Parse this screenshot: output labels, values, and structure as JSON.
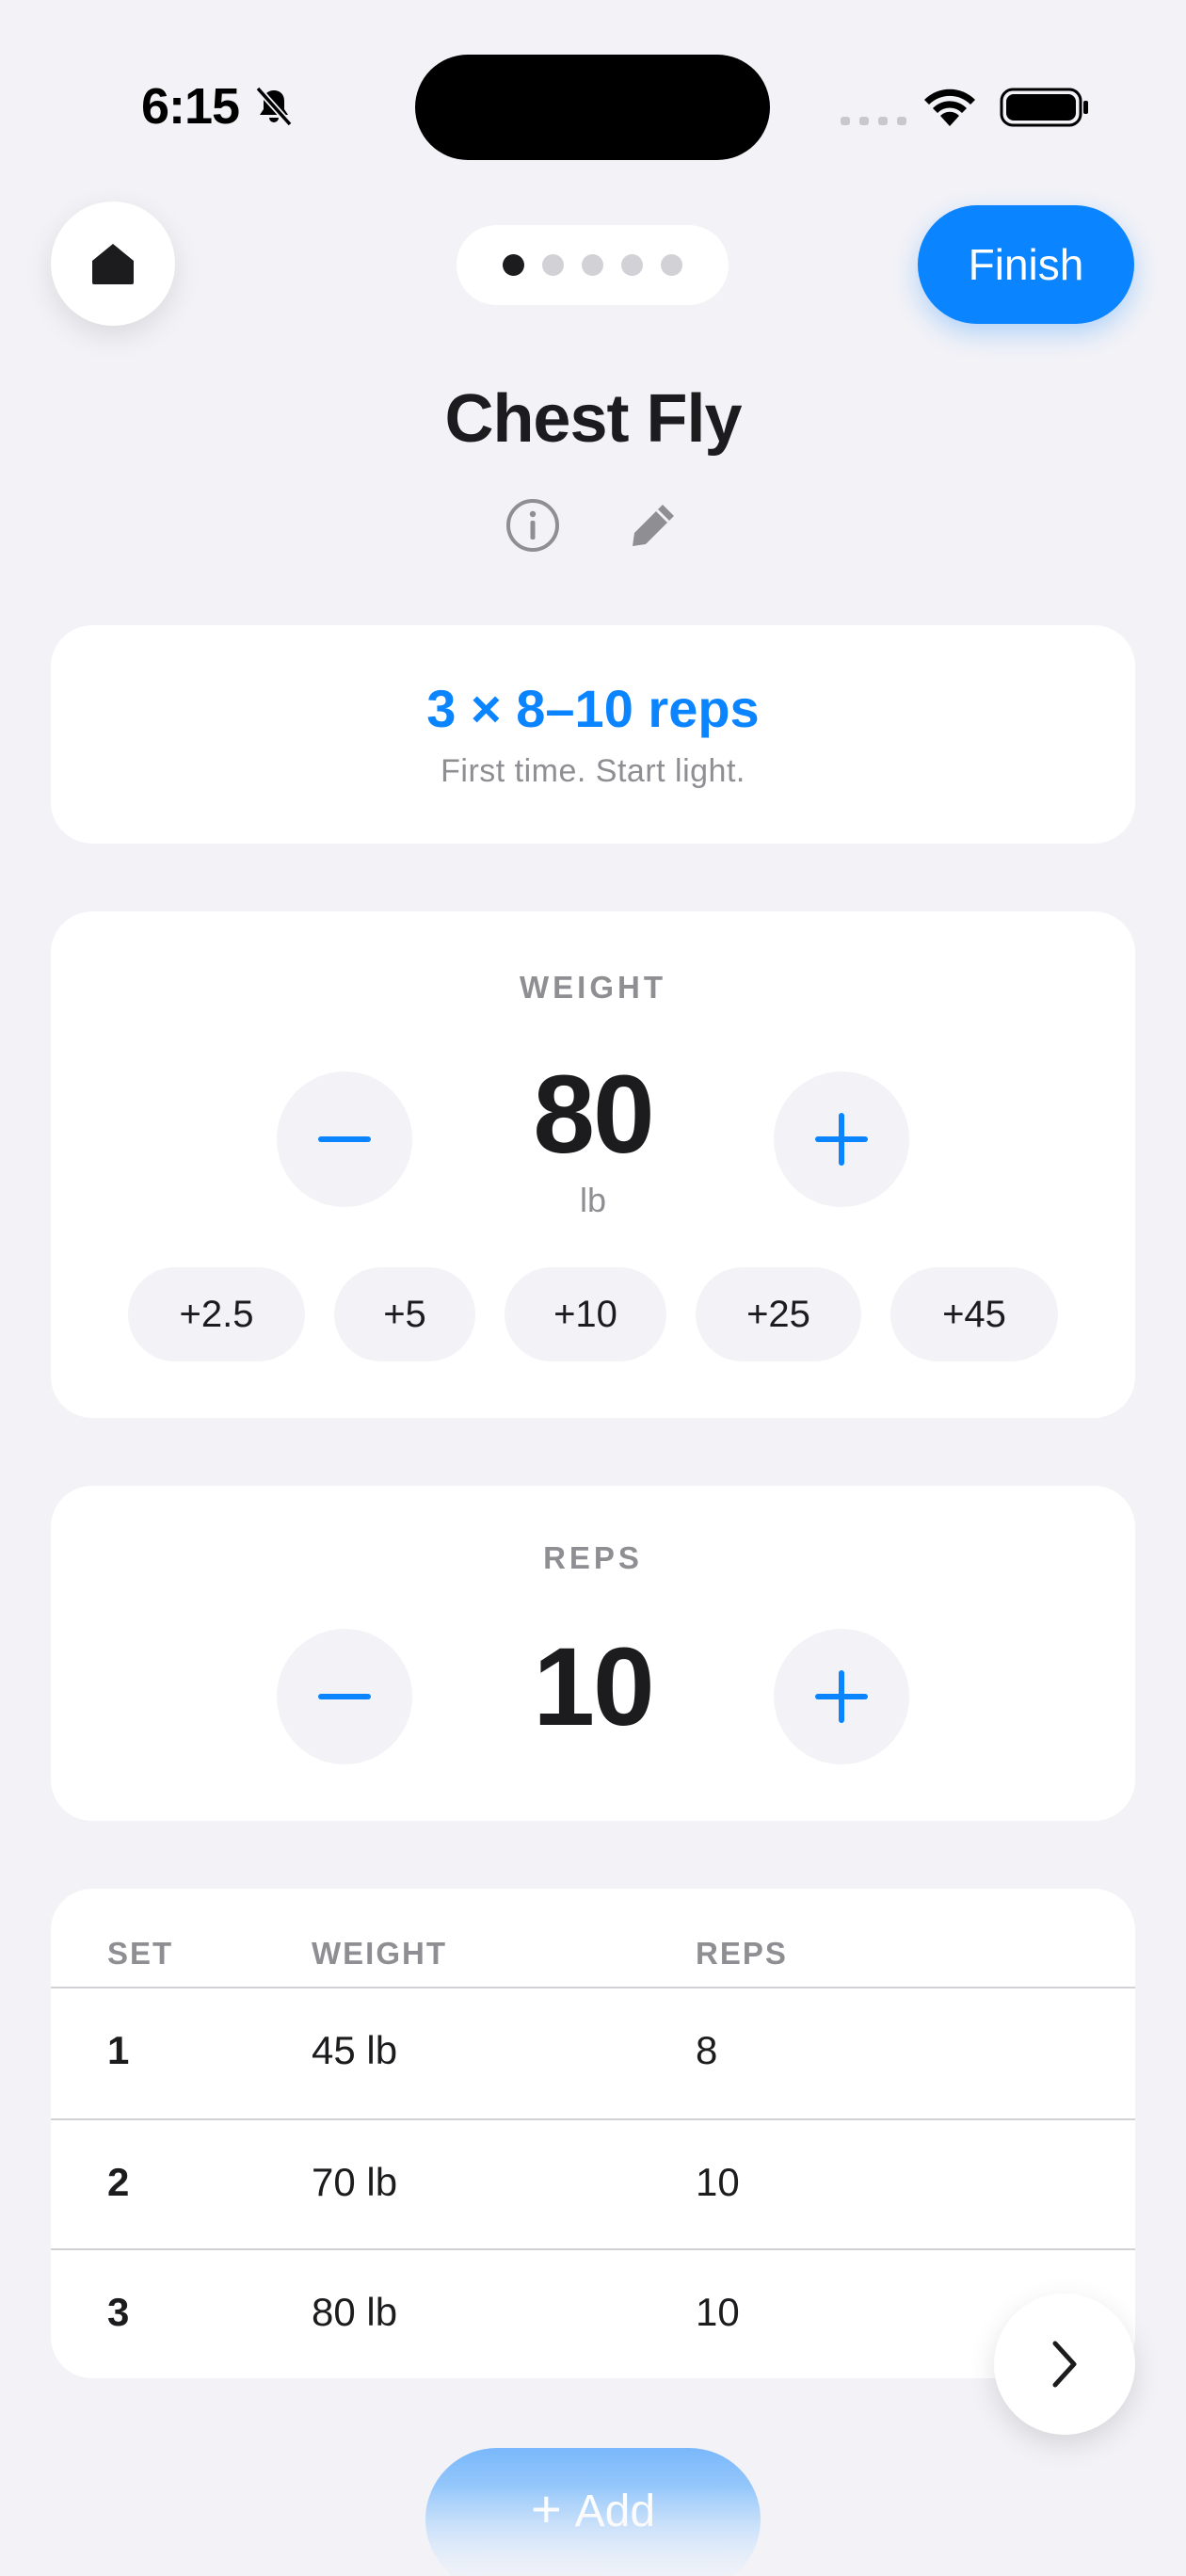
{
  "status_bar": {
    "time": "6:15",
    "silent_icon": "bell-slash-icon",
    "wifi_icon": "wifi-icon",
    "battery_icon": "battery-icon"
  },
  "nav": {
    "home_icon": "house-icon",
    "page_count": 5,
    "current_page": 1,
    "finish_label": "Finish"
  },
  "exercise": {
    "title": "Chest Fly",
    "info_icon": "info-icon",
    "edit_icon": "pencil-icon"
  },
  "target": {
    "text": "3 × 8–10 reps",
    "subtitle": "First time. Start light."
  },
  "weight": {
    "label": "WEIGHT",
    "value": "80",
    "unit": "lb",
    "increments": [
      "+2.5",
      "+5",
      "+10",
      "+25",
      "+45"
    ]
  },
  "reps": {
    "label": "REPS",
    "value": "10"
  },
  "sets_table": {
    "headers": {
      "set": "SET",
      "weight": "WEIGHT",
      "reps": "REPS"
    },
    "rows": [
      {
        "set": "1",
        "weight": "45 lb",
        "reps": "8"
      },
      {
        "set": "2",
        "weight": "70 lb",
        "reps": "10"
      },
      {
        "set": "3",
        "weight": "80 lb",
        "reps": "10"
      }
    ]
  },
  "next_icon": "chevron-right-icon",
  "add_label": "Add",
  "colors": {
    "accent": "#0a84ff",
    "background": "#f2f2f7",
    "text": "#1c1c1e",
    "secondary": "#8e8e93"
  }
}
